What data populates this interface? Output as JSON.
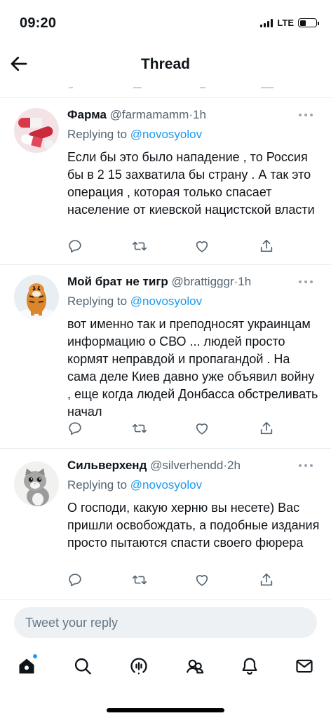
{
  "status_bar": {
    "time": "09:20",
    "network": "LTE"
  },
  "nav": {
    "title": "Thread",
    "back_icon": "arrow-left-icon"
  },
  "tweets": [
    {
      "name": "Фарма",
      "handle": "@farmamamm",
      "sep": "·",
      "time": "1h",
      "replying_prefix": "Replying to",
      "replying_to": "@novosyolov",
      "text": "Если бы это было нападение , то Россия бы в 2 15 захватила бы страну . А так это операция , которая только спасает население от киевской нацистской власти",
      "avatar_icon": "pills-avatar"
    },
    {
      "name": "Мой брат не тигр",
      "handle": "@brattigggr",
      "sep": "·",
      "time": "1h",
      "replying_prefix": "Replying to",
      "replying_to": "@novosyolov",
      "text": "вот именно так и преподносят украинцам информацию о СВО ... людей просто кормят неправдой и пропагандой . На сама деле Киев давно уже объявил войну , еще когда людей Донбасса обстреливать начал",
      "avatar_icon": "tiger-avatar"
    },
    {
      "name": "Сильверхенд",
      "handle": "@silverhendd",
      "sep": "·",
      "time": "2h",
      "replying_prefix": "Replying to",
      "replying_to": "@novosyolov",
      "text": "О господи, какую херню вы несете) Вас пришли освобождать, а подобные издания просто пытаются спасти своего фюрера",
      "avatar_icon": "cat-avatar"
    }
  ],
  "reply_input": {
    "placeholder": "Tweet your reply"
  },
  "tabbar": [
    "home-icon",
    "search-icon",
    "spaces-icon",
    "communities-icon",
    "notifications-icon",
    "messages-icon"
  ],
  "colors": {
    "accent": "#1d9bf0",
    "text": "#0f1419",
    "muted": "#536471",
    "divider": "#e6ecf0"
  }
}
